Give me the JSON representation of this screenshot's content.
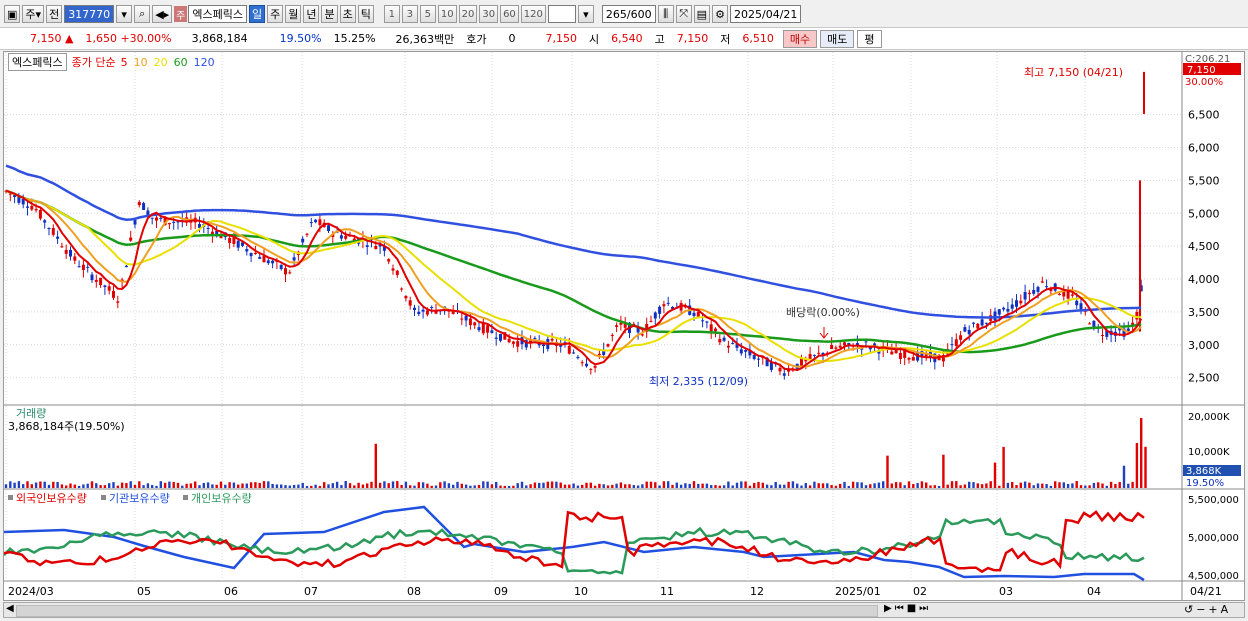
{
  "toolbar": {
    "market": "주",
    "prev": "전",
    "code": "317770",
    "joo": "주",
    "stock_name": "엑스페릭스",
    "periods": [
      "일",
      "주",
      "월",
      "년",
      "분",
      "초",
      "틱"
    ],
    "active_period": "일",
    "intervals": [
      "1",
      "3",
      "5",
      "10",
      "20",
      "30",
      "60",
      "120"
    ],
    "count": "265",
    "count_total": "/600",
    "date": "2025/04/21"
  },
  "quote": {
    "price": "7,150",
    "change": "1,650",
    "change_pct": "+30.00%",
    "volume": "3,868,184",
    "vol_ratio": "19.50%",
    "turnover": "15.25%",
    "amount": "26,363백만",
    "hoga_label": "호가",
    "hoga_value": "0",
    "hoga_price": "7,150",
    "open_label": "시",
    "open": "6,540",
    "high_label": "고",
    "high": "7,150",
    "low_label": "저",
    "low": "6,510",
    "buy": "매수",
    "sell": "매도",
    "pyeong": "평"
  },
  "legend": {
    "name": "엑스페릭스",
    "type": "종가 단순",
    "ma": [
      {
        "label": "5",
        "color": "#e00000"
      },
      {
        "label": "10",
        "color": "#f0a020"
      },
      {
        "label": "20",
        "color": "#e8e000"
      },
      {
        "label": "60",
        "color": "#1a9a1a"
      },
      {
        "label": "120",
        "color": "#3050e0"
      }
    ]
  },
  "chart_data": {
    "type": "candlestick",
    "price_axis": {
      "ticks": [
        "2,500",
        "3,000",
        "3,500",
        "4,000",
        "4,500",
        "5,000",
        "5,500",
        "6,000",
        "6,500"
      ],
      "range": [
        2100,
        7300
      ]
    },
    "top_axis_label": "C:206.21",
    "top_pct_label": "30.00%",
    "current_price_tag": "7,150",
    "annotations": {
      "high": "최고 7,150 (04/21)",
      "low": "최저 2,335 (12/09)",
      "dividend": "배당락(0.00%)"
    },
    "x_labels": [
      "2024/03",
      "05",
      "06",
      "07",
      "08",
      "09",
      "10",
      "11",
      "12",
      "2025/01",
      "02",
      "03",
      "04",
      "04/21"
    ],
    "volume_panel": {
      "title": "거래량",
      "value": "3,868,184주(19.50%)",
      "ticks": [
        "20,000K",
        "10,000K"
      ],
      "current_tag": "3,868K",
      "pct_tag": "19.50%"
    },
    "holdings_panel": {
      "legend": [
        "외국인보유수량",
        "기관보유수량",
        "개인보유수량"
      ],
      "colors": [
        "#e00000",
        "#2050e0",
        "#2a9a5a"
      ],
      "ticks": [
        "5,500,000",
        "5,000,000",
        "4,500,000"
      ]
    }
  }
}
